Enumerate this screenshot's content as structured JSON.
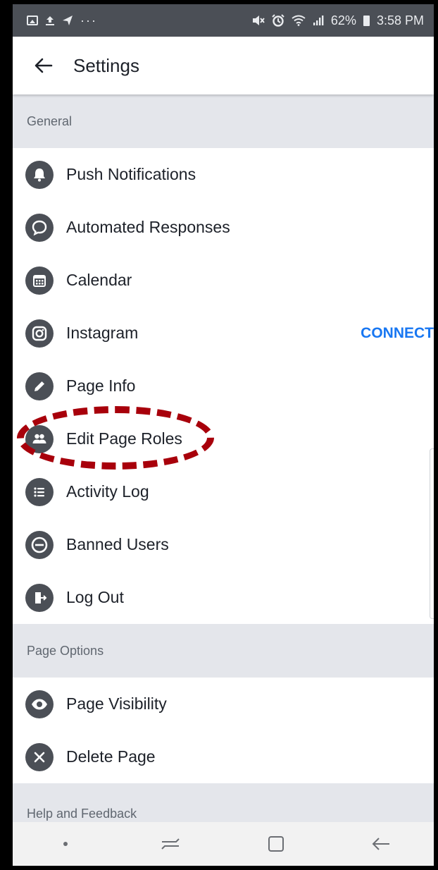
{
  "status_bar": {
    "battery": "62%",
    "time": "3:58 PM",
    "left_icons": [
      "image-icon",
      "upload-icon",
      "send-icon",
      "more-icon"
    ],
    "right_icons": [
      "mute-icon",
      "alarm-icon",
      "wifi-icon",
      "signal-icon",
      "battery-icon"
    ]
  },
  "header": {
    "title": "Settings",
    "back_icon": "back-arrow-icon"
  },
  "sections": {
    "general": {
      "label": "General"
    },
    "page_options": {
      "label": "Page Options"
    },
    "help": {
      "label": "Help and Feedback"
    }
  },
  "items": {
    "push_notifications": {
      "label": "Push Notifications",
      "icon": "bell-icon"
    },
    "automated_responses": {
      "label": "Automated Responses",
      "icon": "chat-bubble-icon"
    },
    "calendar": {
      "label": "Calendar",
      "icon": "calendar-icon"
    },
    "instagram": {
      "label": "Instagram",
      "icon": "instagram-icon",
      "action": "CONNECT"
    },
    "page_info": {
      "label": "Page Info",
      "icon": "pencil-icon"
    },
    "edit_page_roles": {
      "label": "Edit Page Roles",
      "icon": "people-icon"
    },
    "activity_log": {
      "label": "Activity Log",
      "icon": "list-icon"
    },
    "banned_users": {
      "label": "Banned Users",
      "icon": "minus-circle-icon"
    },
    "log_out": {
      "label": "Log Out",
      "icon": "logout-icon"
    },
    "page_visibility": {
      "label": "Page Visibility",
      "icon": "eye-icon"
    },
    "delete_page": {
      "label": "Delete Page",
      "icon": "close-circle-icon"
    }
  },
  "nav_bar": {
    "icons": [
      "dot-icon",
      "recent-apps-icon",
      "home-icon",
      "back-icon"
    ]
  },
  "colors": {
    "accent": "#1877f2",
    "icon": "#4b4f56",
    "section_bg": "#e4e6eb",
    "highlight": "#a8000b"
  }
}
